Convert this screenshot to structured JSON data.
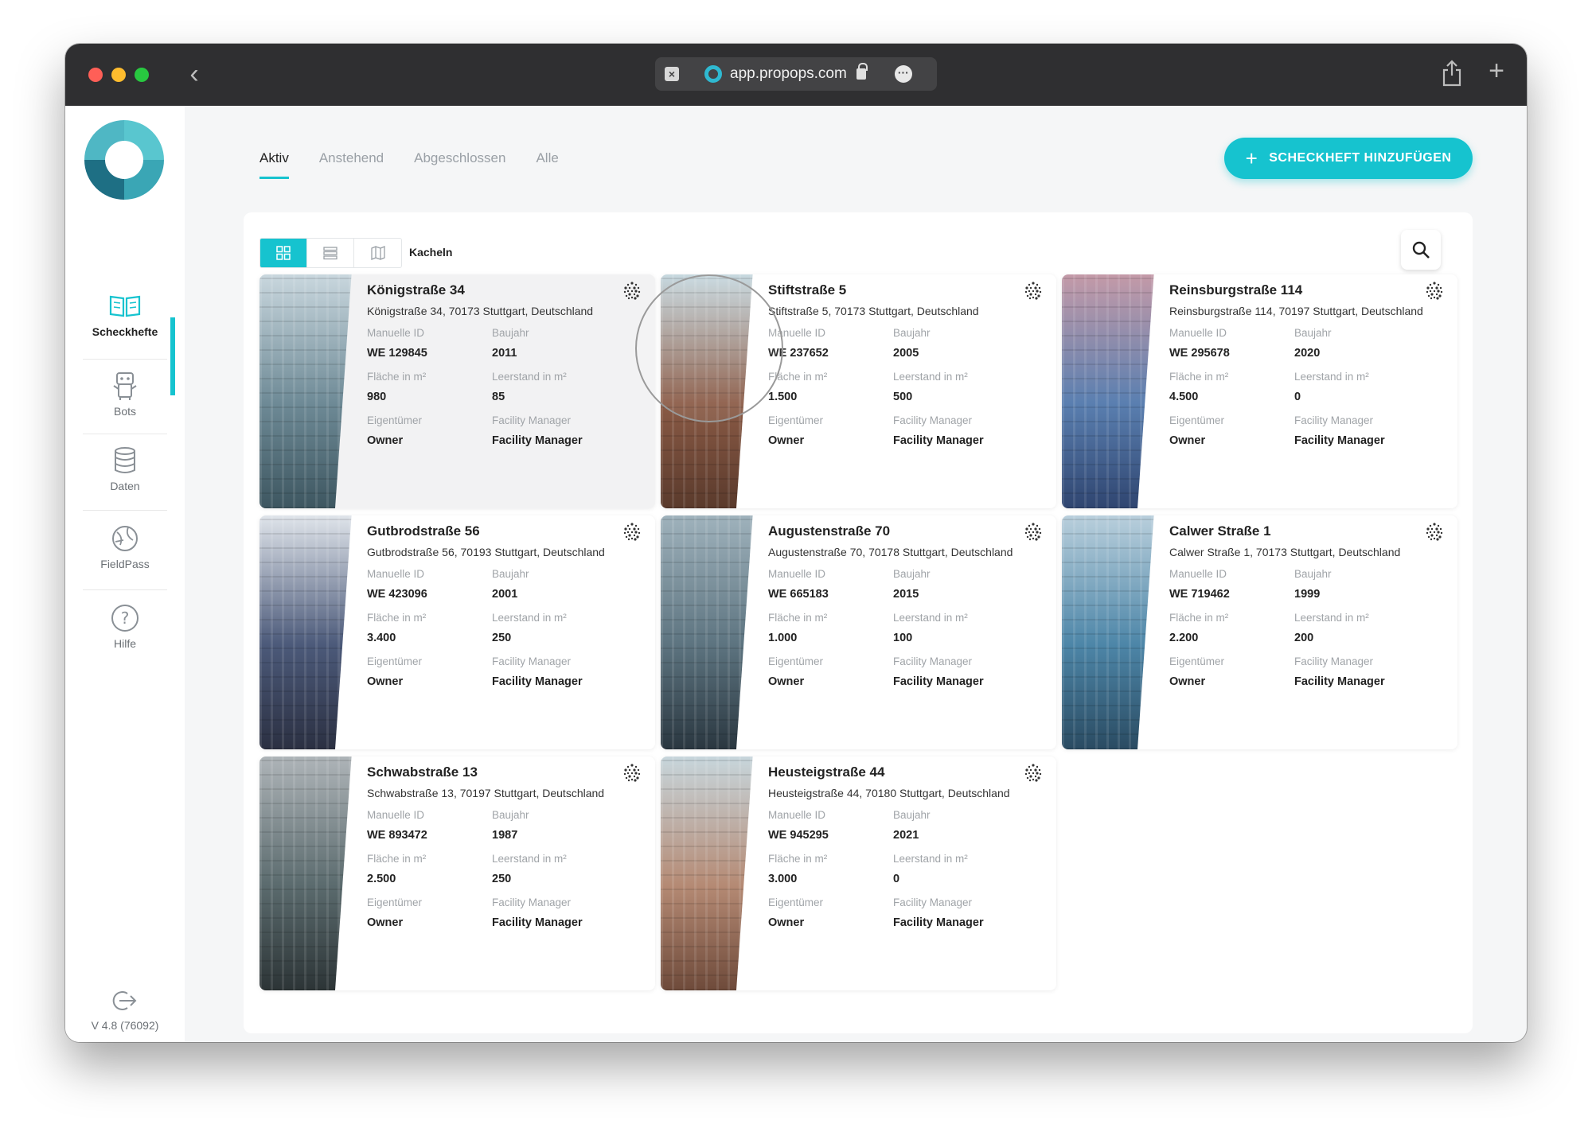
{
  "browser": {
    "url": "app.propops.com"
  },
  "sidebar": {
    "items": [
      {
        "label": "Scheckhefte",
        "icon": "book-open-icon",
        "active": true
      },
      {
        "label": "Bots",
        "icon": "robot-icon",
        "active": false
      },
      {
        "label": "Daten",
        "icon": "database-icon",
        "active": false
      },
      {
        "label": "FieldPass",
        "icon": "globe-pass-icon",
        "active": false
      },
      {
        "label": "Hilfe",
        "icon": "help-icon",
        "active": false
      }
    ],
    "version": "V 4.8 (76092)"
  },
  "tabs": [
    {
      "label": "Aktiv",
      "active": true
    },
    {
      "label": "Anstehend",
      "active": false
    },
    {
      "label": "Abgeschlossen",
      "active": false
    },
    {
      "label": "Alle",
      "active": false
    }
  ],
  "add_button": {
    "label": "SCHECKHEFT HINZUFÜGEN"
  },
  "view": {
    "label": "Kacheln",
    "modes": [
      "grid-view-icon",
      "list-view-icon",
      "map-view-icon"
    ],
    "active": "grid-view-icon"
  },
  "field_labels": {
    "id": "Manuelle ID",
    "year": "Baujahr",
    "area": "Fläche in m²",
    "vacancy": "Leerstand in m²",
    "owner": "Eigentümer",
    "fm": "Facility Manager"
  },
  "cards": [
    {
      "title": "Königstraße 34",
      "address": "Königstraße 34, 70173 Stuttgart, Deutschland",
      "id": "WE 129845",
      "year": "2011",
      "area": "980",
      "vacancy": "85",
      "owner": "Owner",
      "fm": "Facility Manager",
      "colors": [
        "#c9d7de",
        "#6e8a96",
        "#3d5660"
      ]
    },
    {
      "title": "Stiftstraße 5",
      "address": "Stiftstraße 5, 70173 Stuttgart, Deutschland",
      "id": "WE 237652",
      "year": "2005",
      "area": "1.500",
      "vacancy": "500",
      "owner": "Owner",
      "fm": "Facility Manager",
      "colors": [
        "#c7d9e0",
        "#8a5a45",
        "#5a3a2c"
      ]
    },
    {
      "title": "Reinsburgstraße 114",
      "address": "Reinsburgstraße 114, 70197 Stuttgart, Deutschland",
      "id": "WE 295678",
      "year": "2020",
      "area": "4.500",
      "vacancy": "0",
      "owner": "Owner",
      "fm": "Facility Manager",
      "colors": [
        "#c49aa8",
        "#5a7fb0",
        "#2f4570"
      ]
    },
    {
      "title": "Gutbrodstraße 56",
      "address": "Gutbrodstraße 56, 70193 Stuttgart, Deutschland",
      "id": "WE 423096",
      "year": "2001",
      "area": "3.400",
      "vacancy": "250",
      "owner": "Owner",
      "fm": "Facility Manager",
      "colors": [
        "#dfe4ea",
        "#4c5a7a",
        "#2b3042"
      ]
    },
    {
      "title": "Augustenstraße 70",
      "address": "Augustenstraße 70, 70178 Stuttgart, Deutschland",
      "id": "WE 665183",
      "year": "2015",
      "area": "1.000",
      "vacancy": "100",
      "owner": "Owner",
      "fm": "Facility Manager",
      "colors": [
        "#9fb2bc",
        "#5d7480",
        "#2a3740"
      ]
    },
    {
      "title": "Calwer Straße 1",
      "address": "Calwer Straße 1, 70173 Stuttgart, Deutschland",
      "id": "WE 719462",
      "year": "1999",
      "area": "2.200",
      "vacancy": "200",
      "owner": "Owner",
      "fm": "Facility Manager",
      "colors": [
        "#b9cfdc",
        "#4d86a8",
        "#2a4b62"
      ]
    },
    {
      "title": "Schwabstraße 13",
      "address": "Schwabstraße 13, 70197 Stuttgart, Deutschland",
      "id": "WE 893472",
      "year": "1987",
      "area": "2.500",
      "vacancy": "250",
      "owner": "Owner",
      "fm": "Facility Manager",
      "colors": [
        "#aeb4b8",
        "#5b6b6e",
        "#2c3436"
      ]
    },
    {
      "title": "Heusteigstraße 44",
      "address": "Heusteigstraße 44, 70180 Stuttgart, Deutschland",
      "id": "WE 945295",
      "year": "2021",
      "area": "3.000",
      "vacancy": "0",
      "owner": "Owner",
      "fm": "Facility Manager",
      "colors": [
        "#c7d6dc",
        "#b58a74",
        "#6e4a3a"
      ]
    }
  ],
  "colors": {
    "accent": "#16c3cf",
    "titlebar": "#2f2f31"
  }
}
